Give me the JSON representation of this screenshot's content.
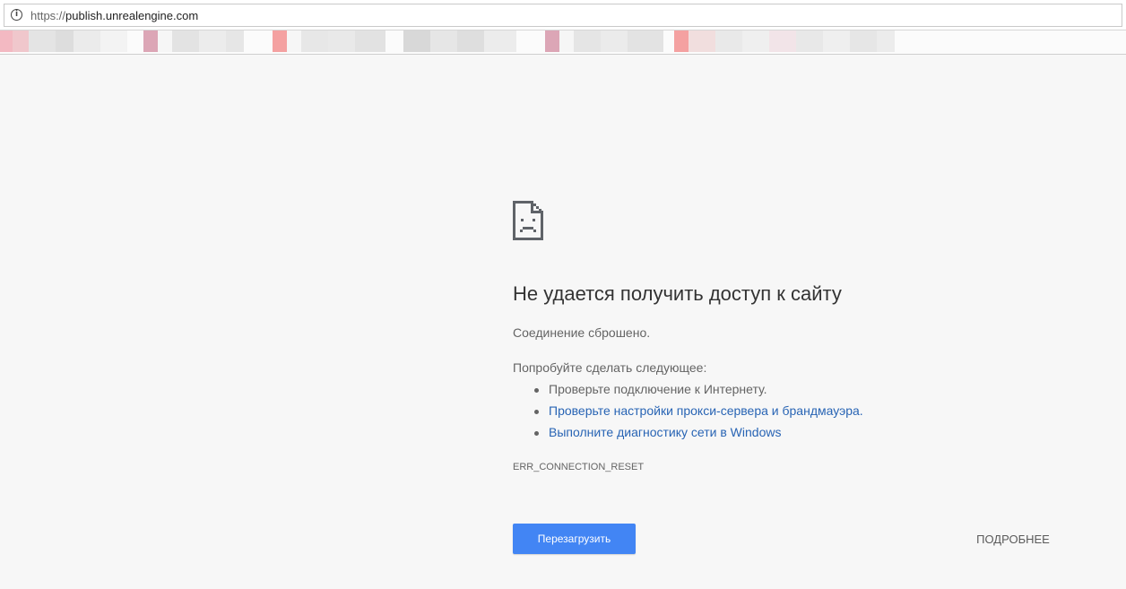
{
  "address_bar": {
    "url_scheme": "https://",
    "url_host": "publish.unrealengine.com",
    "info_icon": "info-icon"
  },
  "bookmarks_bar": {
    "note": ""
  },
  "error_page": {
    "icon": "sad-page-icon",
    "title": "Не удается получить доступ к сайту",
    "subtitle": "Соединение сброшено.",
    "try_heading": "Попробуйте сделать следующее:",
    "suggestions": [
      {
        "text": "Проверьте подключение к Интернету."
      },
      {
        "text": "Проверьте настройки прокси-сервера и брандмауэра."
      },
      {
        "text": "Выполните диагностику сети в Windows"
      }
    ],
    "error_code": "ERR_CONNECTION_RESET",
    "reload_label": "Перезагрузить",
    "details_label": "ПОДРОБНЕЕ",
    "colors": {
      "background": "#f7f7f7",
      "button": "#4285f4",
      "link": "#2864b4",
      "text": "#646464"
    }
  }
}
